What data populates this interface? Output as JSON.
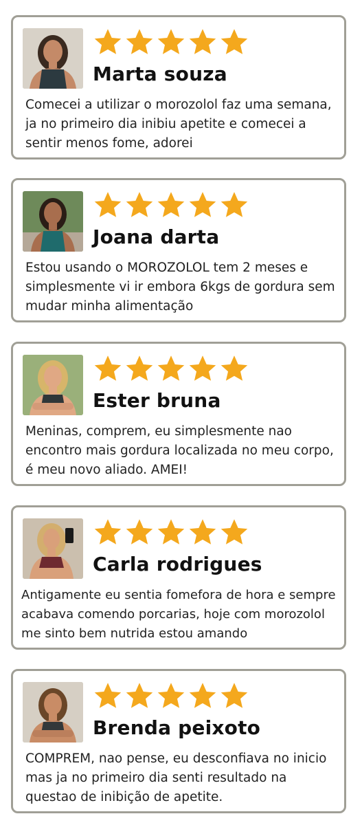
{
  "colors": {
    "star": "#f4a81d",
    "border": "#a09f96"
  },
  "reviews": [
    {
      "name": "Marta souza",
      "rating": 5,
      "text": "Comecei a utilizar o morozolol faz uma semana, ja no primeiro dia inibiu apetite e comecei a sentir menos fome, adorei",
      "avatar": "woman-dark-hair-tank-top-photo"
    },
    {
      "name": "Joana darta",
      "rating": 5,
      "text": "Estou usando o MOROZOLOL tem 2 meses e simplesmente vi ir embora 6kgs de gordura sem mudar minha alimentação",
      "avatar": "woman-teal-tank-top-park-photo"
    },
    {
      "name": "Ester bruna",
      "rating": 5,
      "text": "Meninas, comprem, eu simplesmente nao encontro mais gordura localizada no meu corpo, é meu novo aliado. AMEI!",
      "avatar": "woman-blonde-arms-crossed-photo"
    },
    {
      "name": "Carla rodrigues",
      "rating": 5,
      "text": "Antigamente eu sentia fomefora de hora e sempre acabava comendo porcarias, hoje com morozolol me sinto bem nutrida estou amando",
      "avatar": "woman-mirror-selfie-photo"
    },
    {
      "name": "Brenda peixoto",
      "rating": 5,
      "text": "COMPREM, nao pense, eu desconfiava no inicio mas ja no primeiro dia senti resultado na questao de inibição de apetite.",
      "avatar": "woman-arms-crossed-photo"
    }
  ]
}
